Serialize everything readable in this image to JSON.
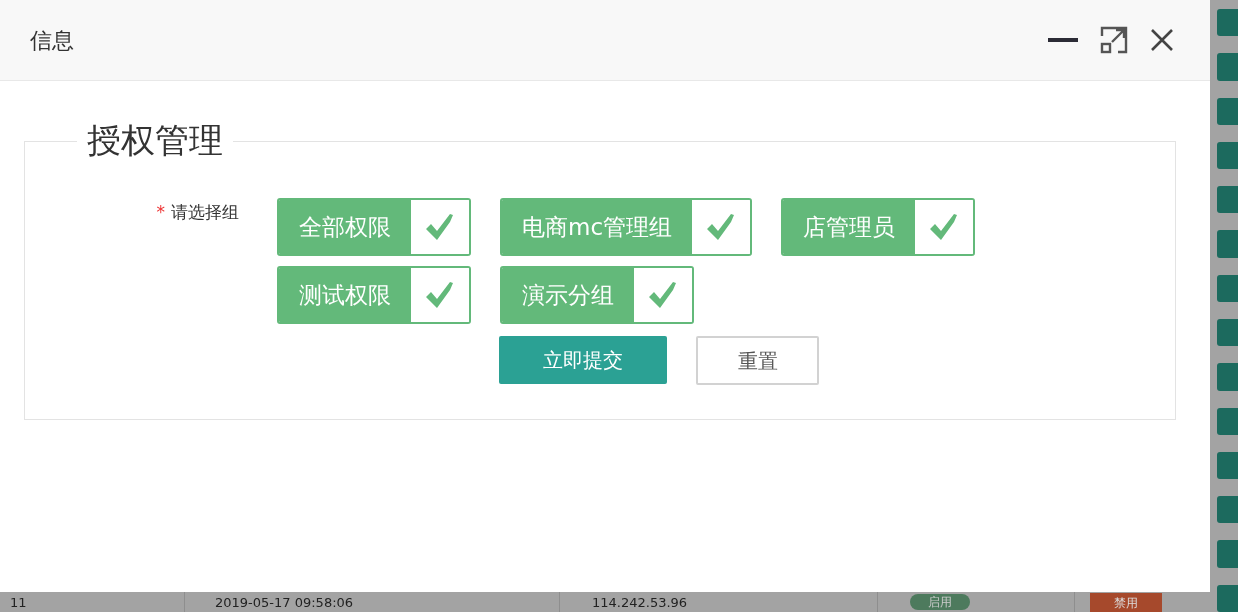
{
  "dialog": {
    "title": "信息"
  },
  "form": {
    "legend": "授权管理",
    "field_label": {
      "required_mark": "*",
      "text": "请选择组"
    },
    "groups": [
      {
        "label": "全部权限",
        "checked": true
      },
      {
        "label": "电商mc管理组",
        "checked": true
      },
      {
        "label": "店管理员",
        "checked": true
      },
      {
        "label": "测试权限",
        "checked": true
      },
      {
        "label": "演示分组",
        "checked": true
      }
    ],
    "buttons": [
      {
        "label": "立即提交",
        "kind": "primary"
      },
      {
        "label": "重置",
        "kind": "secondary"
      }
    ]
  },
  "background_row": {
    "cells": [
      "11",
      "2019-05-17 09:58:06",
      "114.242.53.96"
    ],
    "status_badge": "启用",
    "action_button": "禁用"
  }
}
